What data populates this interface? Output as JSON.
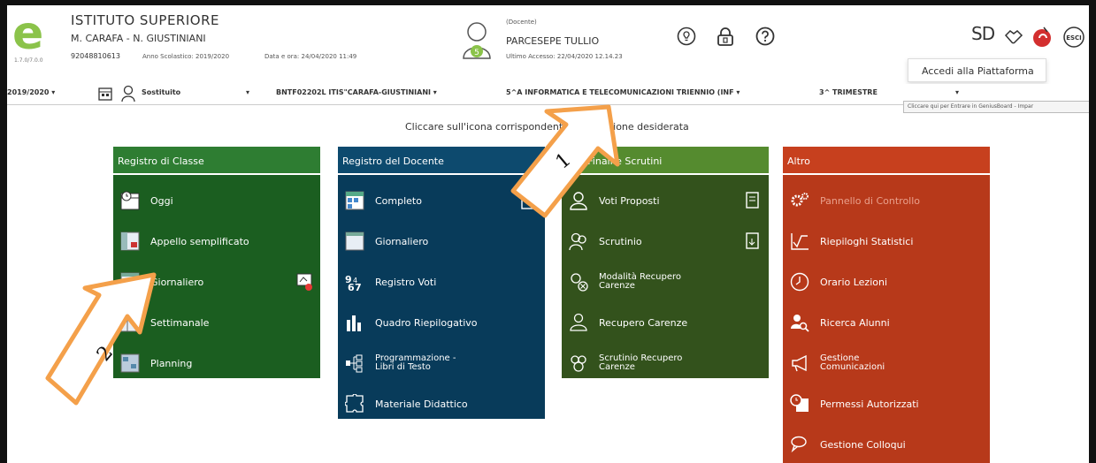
{
  "school": {
    "name": "ISTITUTO SUPERIORE",
    "subtitle": "M. CARAFA - N. GIUSTINIANI",
    "code": "92048810613",
    "year": "Anno Scolastico: 2019/2020",
    "datetime": "Data e ora: 24/04/2020 11:49",
    "version": "1.7.0/7.0.0"
  },
  "user": {
    "role": "(Docente)",
    "name": "PARCESEPE TULLIO",
    "last_access": "Ultimo Accesso: 22/04/2020 12.14.23",
    "avatar_badge": "5"
  },
  "header_icons": [
    "lightbulb-icon",
    "lock-icon",
    "help-icon"
  ],
  "right_icons": {
    "brand": "SD",
    "exit_label": "ESCI"
  },
  "platform_menu": {
    "label": "Accedi alla Piattaforma"
  },
  "nav": {
    "year": "2019/2020",
    "substitute": "Sostituito",
    "school_select": "BNTF02202L ITIS\"CARAFA-GIUSTINIANI",
    "class_select": "5^A INFORMATICA E TELECOMUNICAZIONI TRIENNIO (INF",
    "period_select": "3^ TRIMESTRE",
    "tooltip": "Cliccare qui per Entrare in GeniusBoard - Impar"
  },
  "instruction": "Cliccare sull'icona corrispondente alla funzione desiderata",
  "columns": [
    {
      "title": "Registro di Classe",
      "items": [
        "Oggi",
        "Appello semplificato",
        "Giornaliero",
        "Settimanale",
        "Planning"
      ]
    },
    {
      "title": "Registro del Docente",
      "items": [
        "Completo",
        "Giornaliero",
        "Registro Voti",
        "Quadro Riepilogativo",
        "Programmazione -\nLibri di Testo",
        "Materiale Didattico"
      ]
    },
    {
      "title": "Voti Finali e Scrutini",
      "items": [
        "Voti Proposti",
        "Scrutinio",
        "Modalità Recupero\nCarenze",
        "Recupero Carenze",
        "Scrutinio Recupero\nCarenze"
      ]
    },
    {
      "title": "Altro",
      "items": [
        "Pannello di Controllo",
        "Riepiloghi Statistici",
        "Orario Lezioni",
        "Ricerca Alunni",
        "Gestione\nComunicazioni",
        "Permessi Autorizzati",
        "Gestione Colloqui"
      ]
    }
  ],
  "annotations": {
    "arrow1": "1",
    "arrow2": "2"
  },
  "colors": {
    "col1": "#1b5e20",
    "col2": "#083b5a",
    "col3": "#33521c",
    "col4": "#b7391a",
    "arrow": "#f4a04a"
  }
}
